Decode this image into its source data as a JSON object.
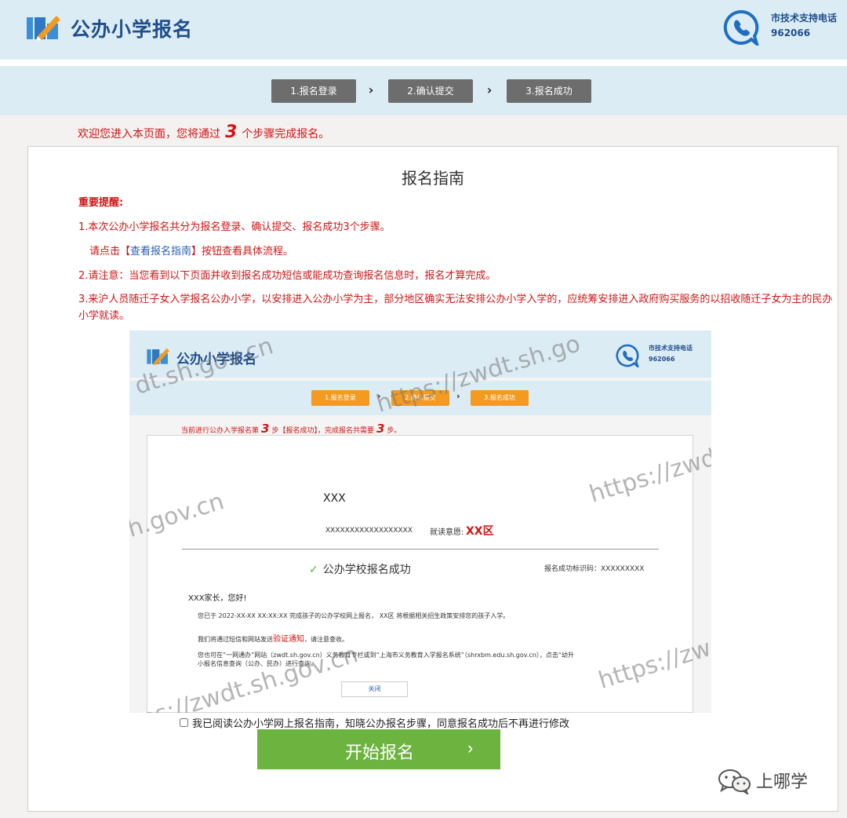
{
  "header": {
    "logo_text": "公办小学报名",
    "phone_label": "市技术支持电话",
    "phone_number": "962066"
  },
  "steps": [
    "1.报名登录",
    "2.确认提交",
    "3.报名成功"
  ],
  "welcome": {
    "prefix": "欢迎您进入本页面，您将通过",
    "count": "3",
    "suffix": "个步骤完成报名。"
  },
  "guide": {
    "title": "报名指南",
    "notice_title": "重要提醒:",
    "note1": "1.本次公办小学报名共分为报名登录、确认提交、报名成功3个步骤。",
    "note1_prefix": "请点击【",
    "note1_link": "查看报名指南",
    "note1_suffix": "】按钮查看具体流程。",
    "note2": "2.请注意：当您看到以下页面并收到报名成功短信或能成功查询报名信息时，报名才算完成。",
    "note3": "3.来沪人员随迁子女入学报名公办小学，以安排进入公办小学为主，部分地区确实无法安排公办小学入学的，应统筹安排进入政府购买服务的以招收随迁子女为主的民办小学就读。"
  },
  "sample": {
    "logo_text": "公办小学报名",
    "phone_label": "市技术支持电话",
    "phone_number": "962066",
    "steps": [
      "1.报名登录",
      "2.确认提交",
      "3.报名成功"
    ],
    "progress_prefix": "当前进行公办入学报名第",
    "progress_step": "3",
    "progress_mid": "步【报名成功】，完成报名共需要",
    "progress_total": "3",
    "progress_suffix": "步。",
    "name": "XXX",
    "id_number": "XXXXXXXXXXXXXXXXXX",
    "school_label": "就读意愿:",
    "school_value": "XX区",
    "success_text": "公办学校报名成功",
    "code_text": "报名成功标识码：XXXXXXXXX",
    "greeting": "XXX家长，您好!",
    "line1": "您已于 2022-XX-XX XX:XX:XX  完成孩子的公办学校网上报名，  XX区 将根据相关招生政策安排您的孩子入学。",
    "line2_prefix": "我们将通过短信和网站发送",
    "line2_red": "验证通知",
    "line2_suffix": "，请注意查收。",
    "line3": "您也可在“一网通办”网站（zwdt.sh.gov.cn）义务教育专栏或到“上海市义务教育入学报名系统”（shrxbm.edu.sh.gov.cn），点击“幼升",
    "line4": "小报名信息查询（公办、民办）进行查询。",
    "close_label": "关闭",
    "watermarks": [
      "dt.sh.gov.cn",
      "https://zwdt.sh.go",
      "https://zwd",
      "h.gov.cn",
      "https://zw",
      "ttps://zwdt.sh.gov.cn"
    ]
  },
  "agreement": "我已阅读公办小学网上报名指南，知晓公办报名步骤，同意报名成功后不再进行修改",
  "start_button": "开始报名",
  "brand": "上哪学",
  "colors": {
    "header_bg": "#dcecf5",
    "brand_blue": "#1f4e8c",
    "alert_red": "#d11414",
    "step_gray": "#6d6d6d",
    "step_orange": "#f39a1f",
    "start_green": "#6db33f"
  }
}
